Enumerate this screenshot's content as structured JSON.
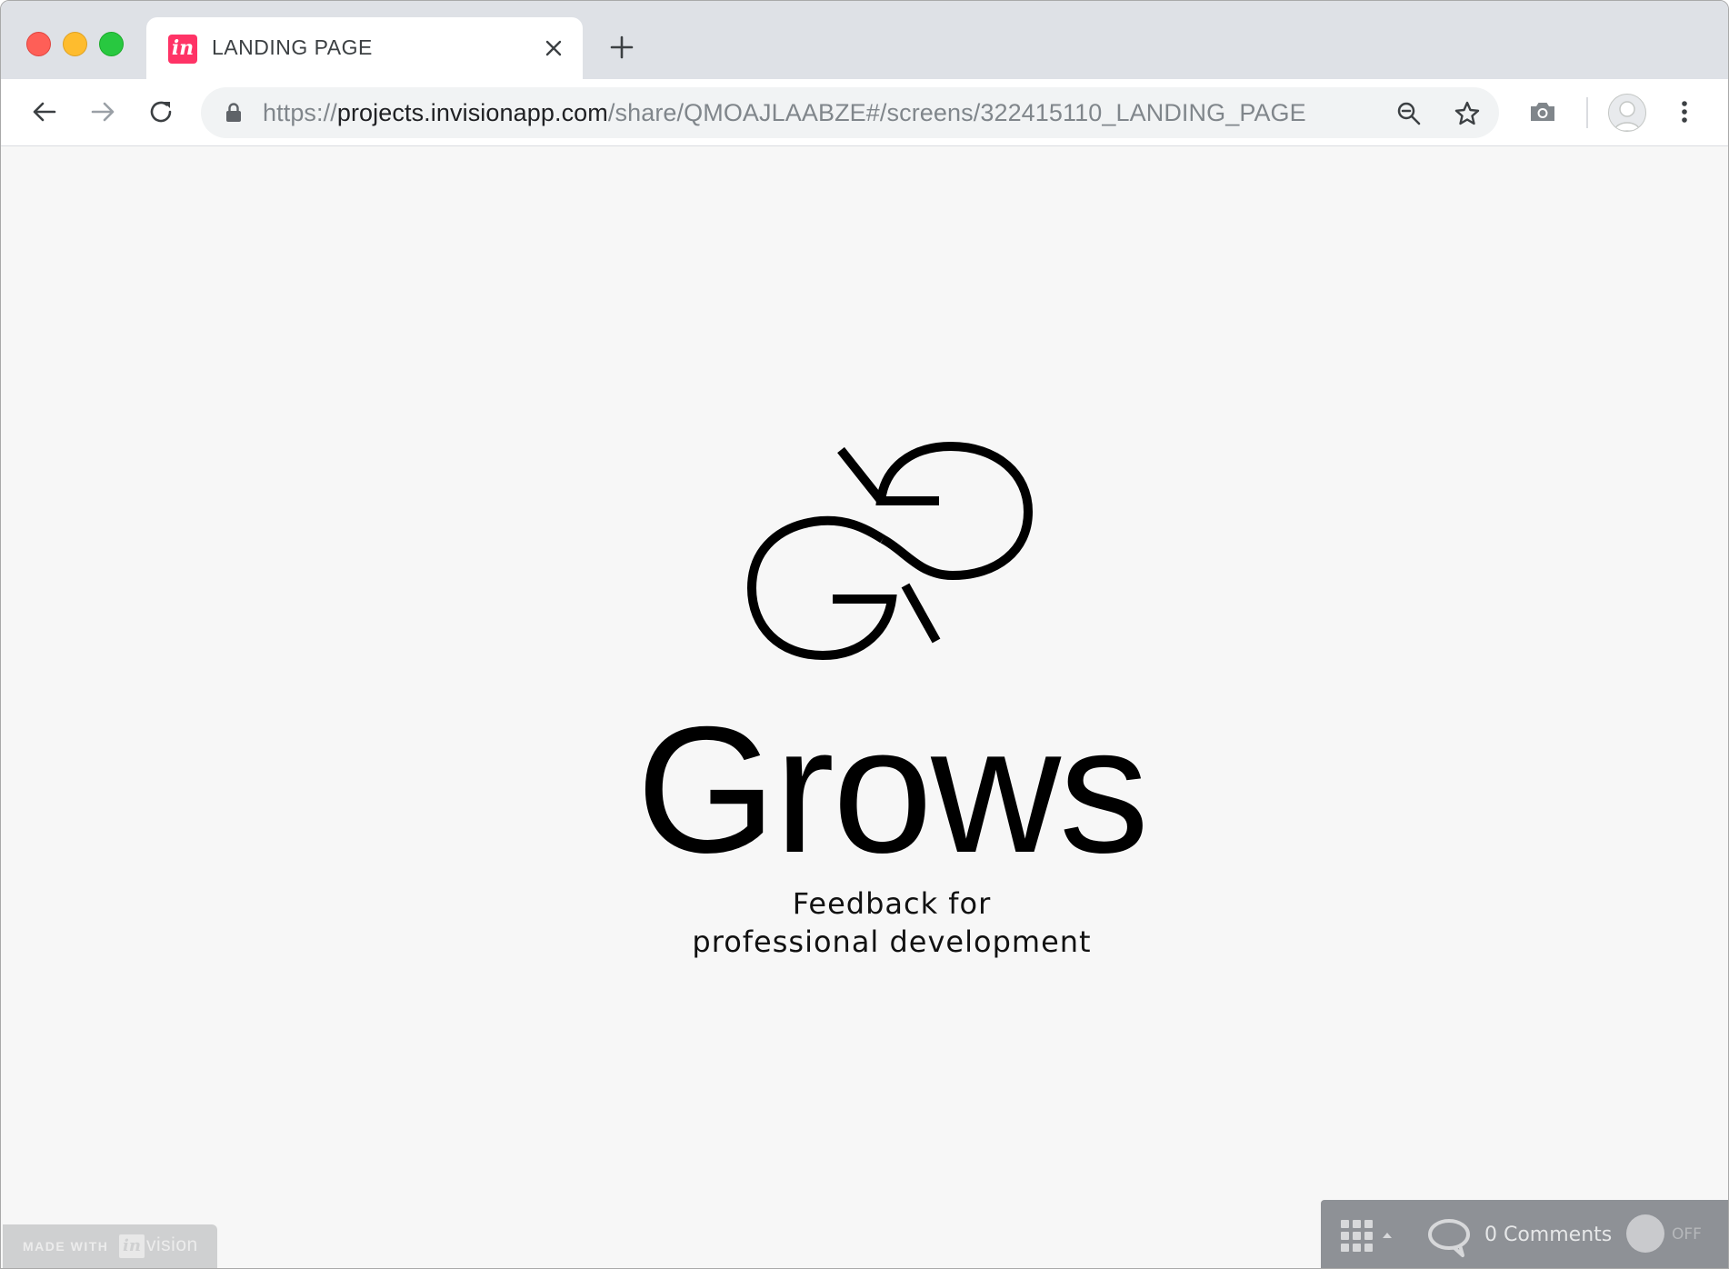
{
  "tab": {
    "favicon_text": "in",
    "title": "LANDING PAGE"
  },
  "address_bar": {
    "scheme": "https://",
    "host": "projects.invisionapp.com",
    "path": "/share/QMOAJLAABZE#/screens/322415110_LANDING_PAGE"
  },
  "page": {
    "brand": "Grows",
    "tagline_line1": "Feedback for",
    "tagline_line2": "professional development"
  },
  "invision_badge": {
    "made_with": "MADE WITH",
    "in": "in",
    "vision": "vision"
  },
  "invision_toolbar": {
    "comments_label": "0 Comments",
    "toggle_label": "OFF"
  },
  "colors": {
    "brand_accent": "#ff3366",
    "traffic_red": "#fe5f57",
    "traffic_yellow": "#febc2e",
    "traffic_green": "#28c840",
    "logo": "#000000"
  },
  "icons": [
    "close-icon",
    "plus-icon",
    "back-arrow-icon",
    "forward-arrow-icon",
    "reload-icon",
    "lock-icon",
    "zoom-icon",
    "star-icon",
    "camera-icon",
    "profile-icon",
    "more-vertical-icon",
    "grows-logo-icon",
    "grid-icon",
    "comment-icon"
  ]
}
